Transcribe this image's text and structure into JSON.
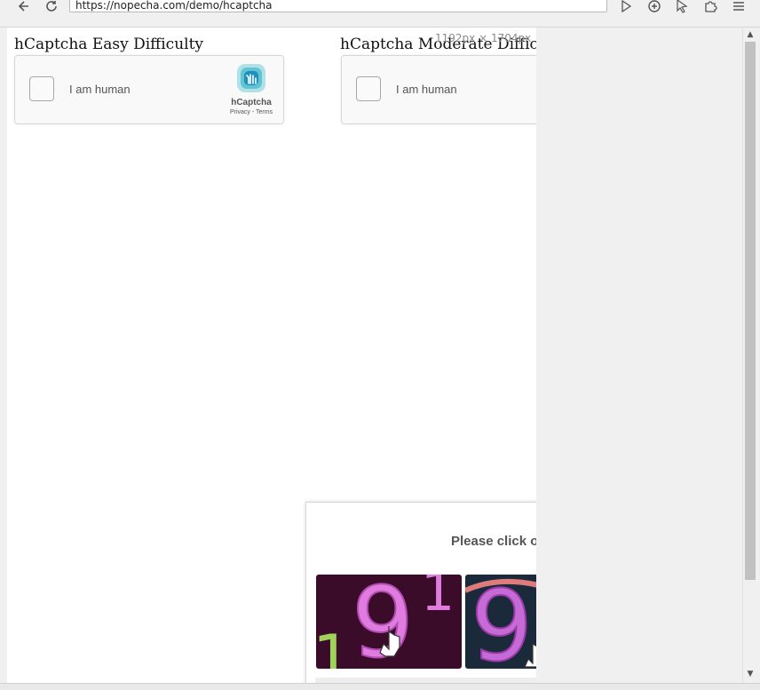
{
  "browser": {
    "url": "https://nopecha.com/demo/hcaptcha",
    "icons": [
      "back-arrow-icon",
      "reload-icon",
      "play-icon",
      "add-circle-icon",
      "cursor-icon",
      "puzzle-icon",
      "menu-icon"
    ]
  },
  "page": {
    "dimensions_tag": "1192px × 1704px",
    "sections": [
      {
        "title": "hCaptcha Easy Difficulty",
        "checkbox_label": "I am human",
        "logo_text": "hCaptcha",
        "logo_links": "Privacy - Terms"
      },
      {
        "title": "hCaptcha Moderate Difficulty",
        "checkbox_label": "I am human"
      }
    ]
  },
  "challenge": {
    "prompt": "Please click o"
  },
  "colors": {
    "tile1_bg": "#3a0c2a",
    "tile2_bg": "#1b2a3a",
    "logo_accent": "#2ab3c6"
  }
}
